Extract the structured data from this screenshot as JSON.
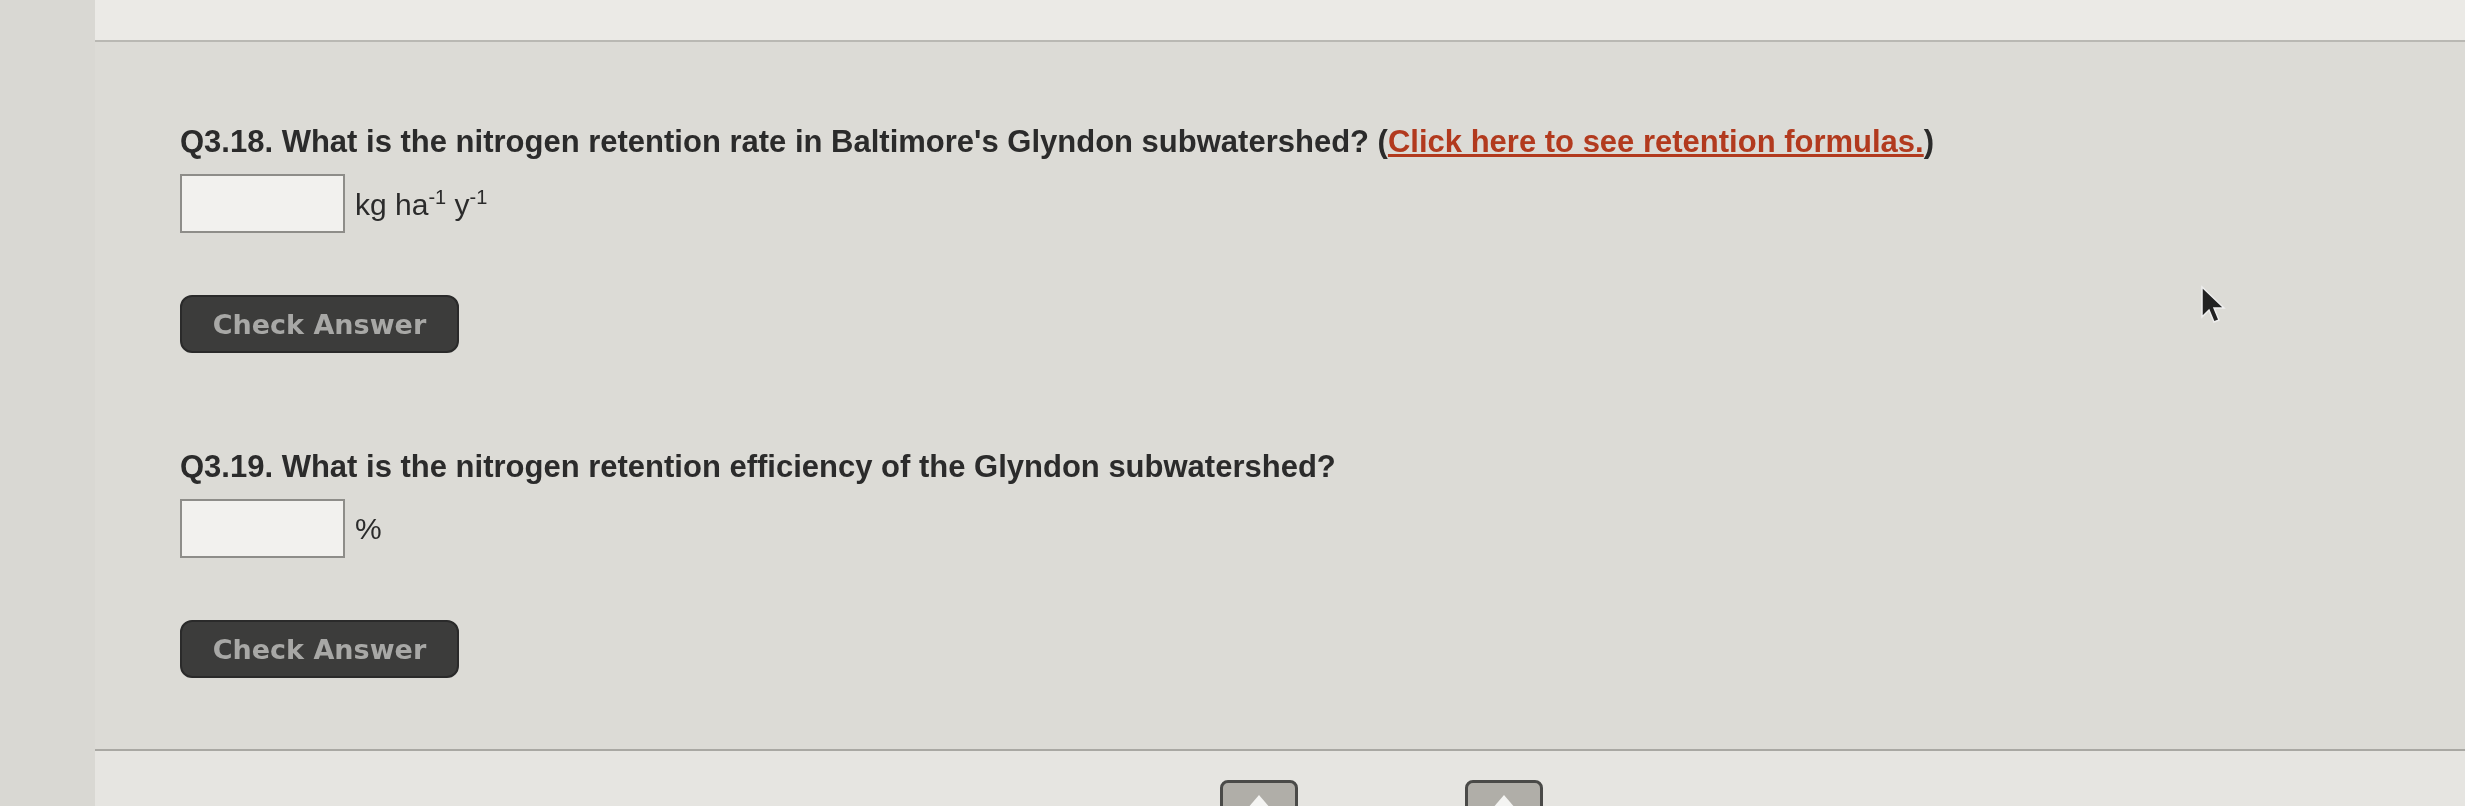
{
  "questions": [
    {
      "text_before": "Q3.18. What is the nitrogen retention rate in Baltimore's Glyndon subwatershed? (",
      "link": "Click here to see retention formulas.",
      "text_after": ")",
      "unit": "kg ha$^{-1}$ y$^{-1}$",
      "button": "Check Answer"
    },
    {
      "text_before": "Q3.19. What is the nitrogen retention efficiency of the Glyndon subwatershed?",
      "unit": "%",
      "button": "Check Answer"
    }
  ],
  "nav": [
    {
      "kind": "up"
    },
    {
      "kind": "up"
    }
  ]
}
